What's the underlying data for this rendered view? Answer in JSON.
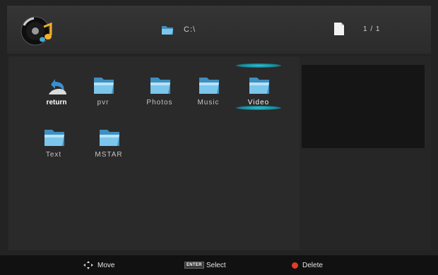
{
  "header": {
    "path": "C:\\",
    "page": "1 / 1"
  },
  "items": [
    {
      "label": "return",
      "kind": "return"
    },
    {
      "label": "pvr",
      "kind": "folder"
    },
    {
      "label": "Photos",
      "kind": "folder"
    },
    {
      "label": "Music",
      "kind": "folder"
    },
    {
      "label": "Video",
      "kind": "folder",
      "selected": true
    },
    {
      "label": "Text",
      "kind": "folder"
    },
    {
      "label": "MSTAR",
      "kind": "folder"
    }
  ],
  "footer": {
    "move_label": "Move",
    "enter_key": "ENTER",
    "select_label": "Select",
    "delete_label": "Delete"
  },
  "colors": {
    "folder": "#4aa7d6",
    "selection": "#2fc4d6",
    "delete": "#e53a2a"
  }
}
